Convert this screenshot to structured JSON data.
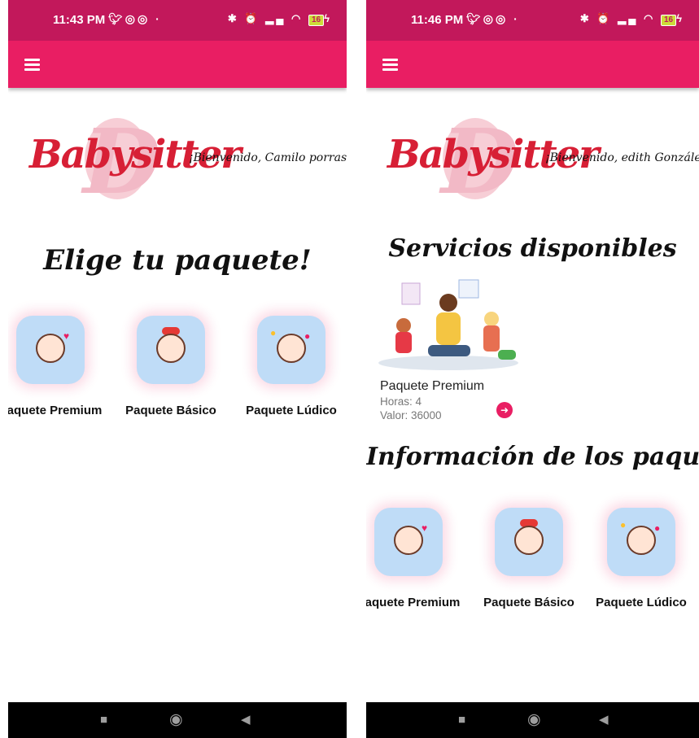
{
  "left": {
    "status": {
      "time": "11:43 PM",
      "battery": "16"
    },
    "welcome": "¡Bienvenido, Camilo porras !",
    "heading": "Elige tu paquete!",
    "packages": [
      {
        "label": "Paquete Premium",
        "icon": "mother-baby-sticker"
      },
      {
        "label": "Paquete Básico",
        "icon": "baby-with-bow-sticker"
      },
      {
        "label": "Paquete Lúdico",
        "icon": "kids-with-balloons-sticker"
      }
    ]
  },
  "right": {
    "status": {
      "time": "11:46 PM",
      "battery": "16"
    },
    "welcome": "¡Bienvenido, edith González !",
    "services_heading": "Servicios disponibles",
    "service": {
      "title": "Paquete Premium",
      "hours": "Horas: 4",
      "value": "Valor: 36000"
    },
    "info_heading": "Información de los paquetes",
    "packages": [
      {
        "label": "Paquete Premium",
        "icon": "mother-baby-sticker"
      },
      {
        "label": "Paquete Básico",
        "icon": "baby-with-bow-sticker"
      },
      {
        "label": "Paquete Lúdico",
        "icon": "kids-with-balloons-sticker"
      }
    ]
  },
  "app": {
    "logo_text": "Babysitter",
    "logo_letter": "D"
  },
  "colors": {
    "status_bar": "#c2185b",
    "app_bar": "#e91e63",
    "logo_red": "#d71f35",
    "tile": "#bfdcf7"
  }
}
